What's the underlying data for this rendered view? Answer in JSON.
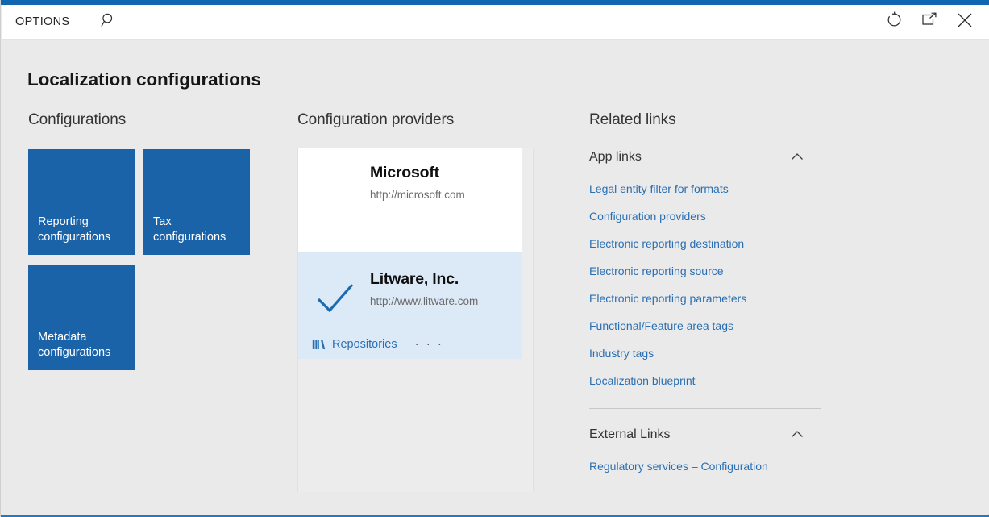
{
  "window": {
    "options_label": "OPTIONS",
    "search_icon": "search-icon",
    "refresh_icon": "refresh-icon",
    "popout_icon": "open-in-new-window-icon",
    "close_icon": "close-icon",
    "accent_color": "#1066b0",
    "bottom_accent_color": "#2079c4"
  },
  "page": {
    "title": "Localization configurations",
    "background": "#eaeaea"
  },
  "configurations": {
    "heading": "Configurations",
    "tile_color": "#1b63a9",
    "tiles": [
      {
        "label": "Reporting configurations"
      },
      {
        "label": "Tax configurations"
      },
      {
        "label": "Metadata configurations"
      }
    ]
  },
  "providers": {
    "heading": "Configuration providers",
    "selected_background": "#dce9f7",
    "cards": [
      {
        "name": "Microsoft",
        "url": "http://microsoft.com",
        "selected": false
      },
      {
        "name": "Litware, Inc.",
        "url": "http://www.litware.com",
        "selected": true,
        "repositories_label": "Repositories",
        "repositories_icon": "books-icon",
        "overflow_label": "· · ·"
      }
    ]
  },
  "related_links": {
    "heading": "Related links",
    "groups": [
      {
        "title": "App links",
        "expanded": true,
        "chevron_icon": "chevron-up-icon",
        "links": [
          "Legal entity filter for formats",
          "Configuration providers",
          "Electronic reporting destination",
          "Electronic reporting source",
          "Electronic reporting parameters",
          "Functional/Feature area tags",
          "Industry tags",
          "Localization blueprint"
        ]
      },
      {
        "title": "External Links",
        "expanded": true,
        "chevron_icon": "chevron-up-icon",
        "links": [
          "Regulatory services – Configuration"
        ]
      }
    ],
    "link_color": "#2a6fb3"
  }
}
